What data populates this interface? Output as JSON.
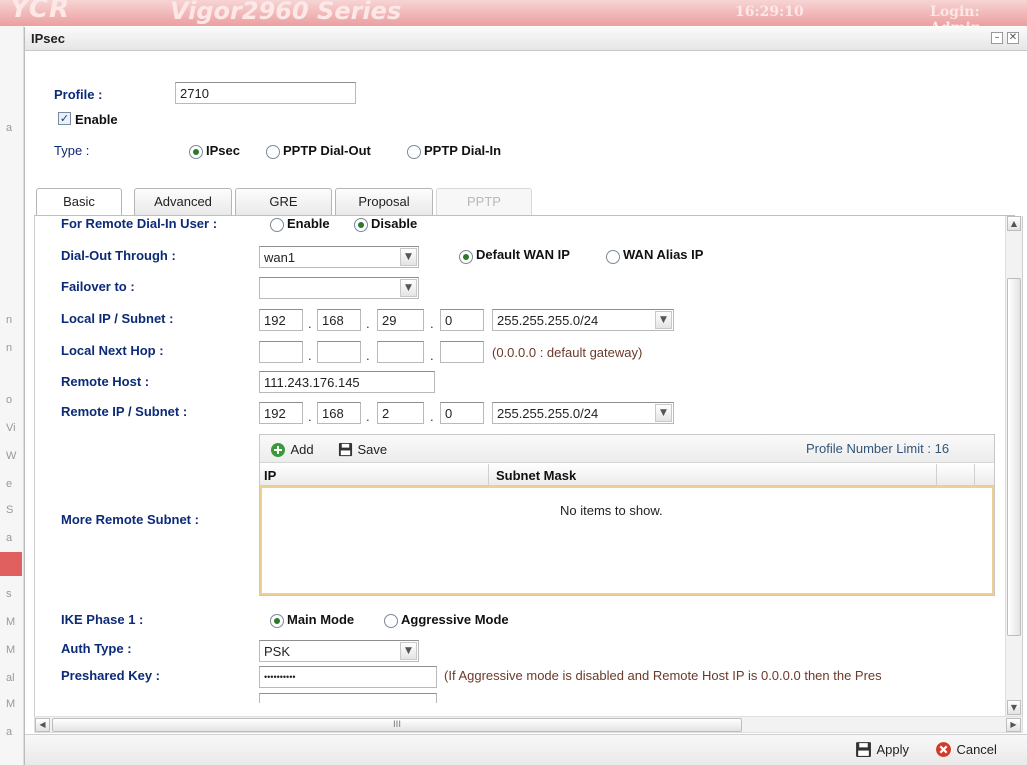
{
  "background": {
    "logo": "YCR",
    "series": "Vigor2960 Series",
    "time": "16:29:10",
    "login": "Login: Admin",
    "sidebar_fragments": [
      "a",
      "n",
      "n",
      "o",
      "Vi",
      "W",
      "e",
      "S",
      "a",
      "s",
      "M",
      "M",
      "al",
      "M",
      "a"
    ]
  },
  "dialog": {
    "title": "IPsec",
    "minimize": "–",
    "close": "✕"
  },
  "profile": {
    "label": "Profile :",
    "value": "2710",
    "enable_label": "Enable",
    "enable_checked": true,
    "type_label": "Type :",
    "type_options": [
      "IPsec",
      "PPTP Dial-Out",
      "PPTP Dial-In"
    ],
    "type_selected": "IPsec"
  },
  "tabs": [
    {
      "label": "Basic",
      "state": "active"
    },
    {
      "label": "Advanced",
      "state": "normal"
    },
    {
      "label": "GRE",
      "state": "normal"
    },
    {
      "label": "Proposal",
      "state": "normal"
    },
    {
      "label": "PPTP",
      "state": "disabled"
    }
  ],
  "form": {
    "remote_dialin": {
      "label": "For Remote Dial-In User :",
      "options": [
        "Enable",
        "Disable"
      ],
      "selected": "Disable"
    },
    "dialout": {
      "label": "Dial-Out Through :",
      "value": "wan1",
      "options": [
        "Default WAN IP",
        "WAN Alias IP"
      ],
      "selected": "Default WAN IP"
    },
    "failover": {
      "label": "Failover to :",
      "value": ""
    },
    "local_ip": {
      "label": "Local IP / Subnet :",
      "octets": [
        "192",
        "168",
        "29",
        "0"
      ],
      "mask": "255.255.255.0/24"
    },
    "local_next_hop": {
      "label": "Local Next Hop :",
      "octets": [
        "",
        "",
        "",
        ""
      ],
      "hint": "(0.0.0.0 : default gateway)"
    },
    "remote_host": {
      "label": "Remote Host :",
      "value": "111.243.176.145"
    },
    "remote_ip": {
      "label": "Remote IP / Subnet :",
      "octets": [
        "192",
        "168",
        "2",
        "0"
      ],
      "mask": "255.255.255.0/24"
    },
    "more_remote_subnet": {
      "label": "More Remote Subnet :",
      "add_label": "Add",
      "save_label": "Save",
      "limit_text": "Profile Number Limit : 16",
      "columns": [
        "IP",
        "Subnet Mask"
      ],
      "empty_text": "No items to show."
    },
    "ike_phase1": {
      "label": "IKE Phase 1 :",
      "options": [
        "Main Mode",
        "Aggressive Mode"
      ],
      "selected": "Main Mode"
    },
    "auth_type": {
      "label": "Auth Type :",
      "value": "PSK"
    },
    "preshared_key": {
      "label": "Preshared Key :",
      "value": "••••••••••",
      "hint": "(If Aggressive mode is disabled and Remote Host IP is 0.0.0.0 then the Pres"
    }
  },
  "scrollbar": {
    "h_grip": "III"
  },
  "footer": {
    "apply_label": "Apply",
    "cancel_label": "Cancel"
  },
  "colors": {
    "label_blue": "#0b2a77",
    "radio_green": "#2a7a2a",
    "cancel_red": "#d23b2b",
    "add_green": "#3a9a3a"
  }
}
